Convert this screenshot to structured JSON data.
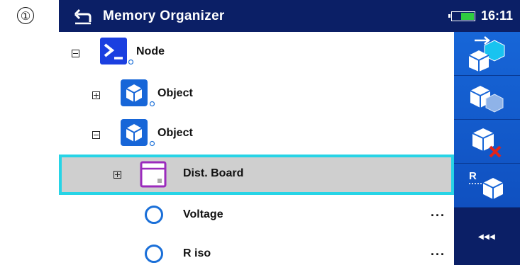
{
  "step_marker": "①",
  "header": {
    "title": "Memory Organizer",
    "time": "16:11",
    "battery_level": 0.6,
    "icons": {
      "back": "back-arrow-icon",
      "battery": "battery-icon"
    }
  },
  "tree": {
    "node": {
      "label": "Node",
      "expanded": true,
      "icon": "terminal-node-icon"
    },
    "object_1": {
      "label": "Object",
      "expanded": false,
      "icon": "object-cube-icon"
    },
    "object_2": {
      "label": "Object",
      "expanded": true,
      "icon": "object-cube-icon"
    },
    "dist_board": {
      "label": "Dist. Board",
      "expanded": false,
      "selected": true,
      "icon": "distribution-board-icon"
    },
    "measurements": [
      {
        "label": "Voltage",
        "more": "...",
        "icon": "measurement-circle-icon"
      },
      {
        "label": "R iso",
        "more": "...",
        "icon": "measurement-circle-icon"
      }
    ]
  },
  "sidebar": {
    "buttons": [
      {
        "icon": "add-structure-icon"
      },
      {
        "icon": "clone-structure-icon"
      },
      {
        "icon": "delete-structure-icon"
      },
      {
        "icon": "rename-structure-icon",
        "letter": "R"
      },
      {
        "icon": "collapse-sidebar-icon",
        "label": "◂◂◂"
      }
    ]
  },
  "colors": {
    "header_bg": "#0b1f66",
    "sidebar_bg": "#1766d8",
    "selection_border": "#27d4e6",
    "selection_bg": "#cfcfcf",
    "accent": "#1a6fd8"
  }
}
